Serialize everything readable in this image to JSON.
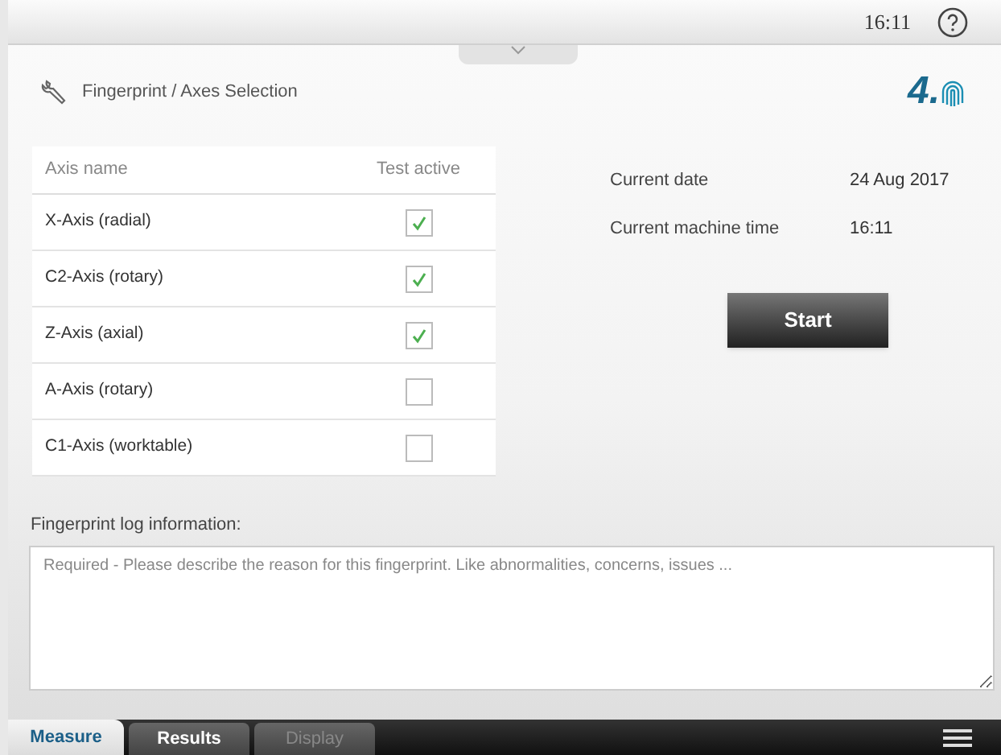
{
  "status_bar": {
    "time": "16:11"
  },
  "header": {
    "title": "Fingerprint / Axes Selection",
    "logo_text": "4."
  },
  "axes_table": {
    "columns": [
      "Axis name",
      "Test active"
    ],
    "rows": [
      {
        "name": "X-Axis (radial)",
        "checked": true
      },
      {
        "name": "C2-Axis (rotary)",
        "checked": true
      },
      {
        "name": "Z-Axis (axial)",
        "checked": true
      },
      {
        "name": "A-Axis (rotary)",
        "checked": false
      },
      {
        "name": "C1-Axis (worktable)",
        "checked": false
      }
    ]
  },
  "info": [
    {
      "label": "Current date",
      "value": "24 Aug 2017"
    },
    {
      "label": "Current machine time",
      "value": "16:11"
    }
  ],
  "start_button": "Start",
  "log": {
    "label": "Fingerprint log information:",
    "placeholder": "Required - Please describe the reason for this fingerprint. Like abnormalities, concerns, issues ..."
  },
  "tabs": [
    {
      "label": "Measure",
      "selected": true,
      "disabled": false
    },
    {
      "label": "Results",
      "selected": false,
      "disabled": false
    },
    {
      "label": "Display",
      "selected": false,
      "disabled": true
    }
  ]
}
